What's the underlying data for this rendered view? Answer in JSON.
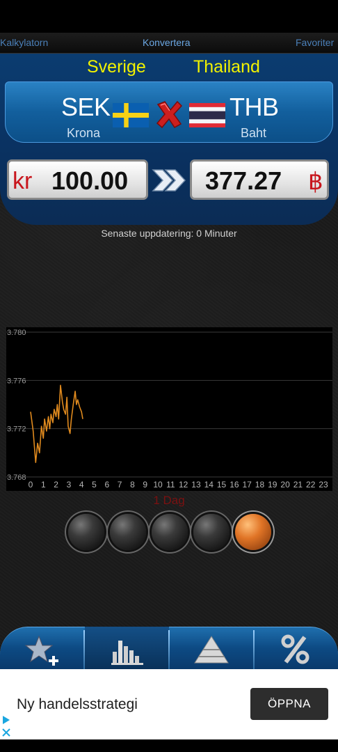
{
  "tabs": [
    {
      "label": "Kalkylatorn"
    },
    {
      "label": "Konvertera"
    },
    {
      "label": "Favoriter"
    }
  ],
  "countries": {
    "from": "Sverige",
    "to": "Thailand"
  },
  "currencies": {
    "from": {
      "code": "SEK",
      "name": "Krona",
      "symbol": "kr",
      "amount": "100.00"
    },
    "to": {
      "code": "THB",
      "name": "Baht",
      "symbol": "฿",
      "amount": "377.27"
    }
  },
  "update_text": "Senaste uppdatering: 0 Minuter",
  "range_label": "1 Dag",
  "range_buttons": 5,
  "range_selected_index": 4,
  "bottom_nav": [
    "star-add-icon",
    "bar-chart-icon",
    "pyramid-icon",
    "percent-icon"
  ],
  "colors": {
    "accent_yellow": "#f2f200",
    "panel_blue": "#0b3c70",
    "series_orange": "#e08a1e",
    "symbol_red": "#c8161d",
    "range_red": "#7a1111"
  },
  "ad": {
    "title": "Ny handelsstrategi",
    "button": "ÖPPNA"
  },
  "chart_data": {
    "type": "line",
    "title": "",
    "xlabel": "",
    "ylabel": "",
    "xlim": [
      0,
      23
    ],
    "ylim": [
      3.768,
      3.78
    ],
    "x_ticks": [
      0,
      1,
      2,
      3,
      4,
      5,
      6,
      7,
      8,
      9,
      10,
      11,
      12,
      13,
      14,
      15,
      16,
      17,
      18,
      19,
      20,
      21,
      22,
      23
    ],
    "y_ticks": [
      "3.768",
      "3.772",
      "3.776",
      "3.780"
    ],
    "grid": true,
    "series": [
      {
        "values_x": [
          0.0,
          0.2,
          0.4,
          0.55,
          0.7,
          0.85,
          1.0,
          1.1,
          1.25,
          1.4,
          1.5,
          1.6,
          1.75,
          1.85,
          2.0,
          2.1,
          2.2,
          2.35,
          2.5,
          2.6,
          2.75,
          2.85,
          2.95,
          3.1,
          3.2,
          3.35,
          3.5,
          3.6,
          3.7,
          3.85,
          4.0,
          4.1
        ],
        "values_y": [
          3.7734,
          3.7718,
          3.7692,
          3.7708,
          3.77,
          3.7722,
          3.7712,
          3.7728,
          3.7718,
          3.773,
          3.772,
          3.7732,
          3.7725,
          3.7736,
          3.773,
          3.774,
          3.7728,
          3.7756,
          3.7742,
          3.7736,
          3.7732,
          3.7746,
          3.7722,
          3.7716,
          3.7728,
          3.774,
          3.7751,
          3.774,
          3.7744,
          3.7738,
          3.7734,
          3.7728
        ]
      }
    ]
  }
}
